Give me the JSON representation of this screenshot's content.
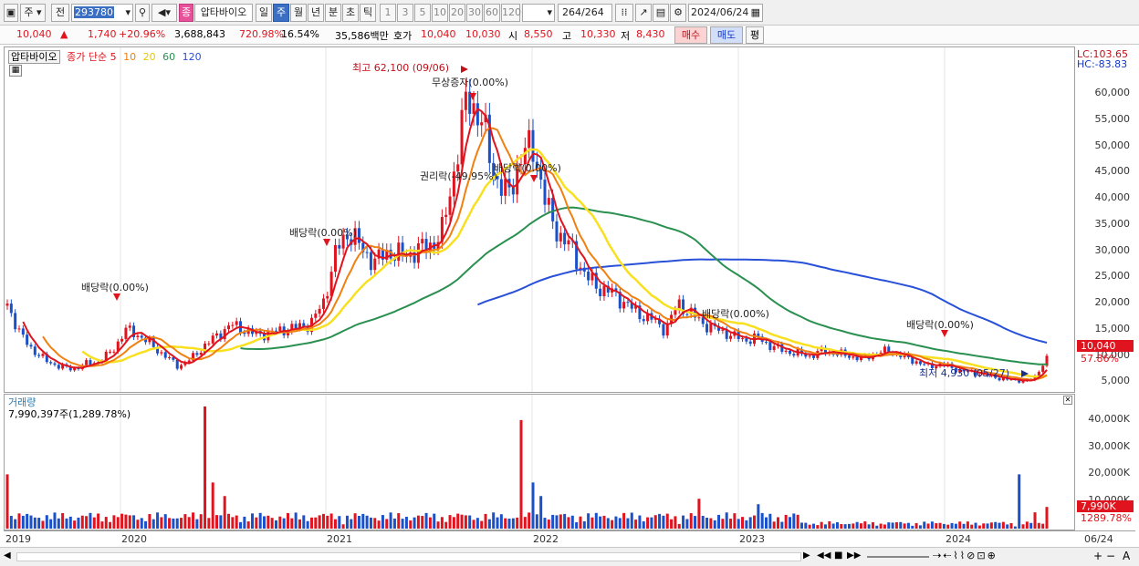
{
  "toolbar": {
    "period_type": "주",
    "prev": "전",
    "code": "293780",
    "name": "압타바이오",
    "intervals": [
      "일",
      "주",
      "월",
      "년",
      "분",
      "초",
      "틱"
    ],
    "selected_interval": "주",
    "minutes": [
      "1",
      "3",
      "5",
      "10",
      "20",
      "30",
      "60",
      "120"
    ],
    "count": "264",
    "count_total": "/264",
    "date": "2024/06/24",
    "pink_label": "종"
  },
  "quote": {
    "price": "10,040",
    "arrow": "▲",
    "change": "1,740",
    "change_pct": "+20.96%",
    "volume": "3,688,843",
    "vol_ratio": "720.98%",
    "turnover": "16.54%",
    "amount": "35,586백만",
    "hoga_label": "호가",
    "ask": "10,040",
    "bid": "10,030",
    "open_label": "시",
    "open": "8,550",
    "high_label": "고",
    "high": "10,330",
    "low_label": "저",
    "low": "8,430",
    "buy": "매수",
    "sell": "매도",
    "eval": "평"
  },
  "price_panel": {
    "stock_label": "압타바이오",
    "ma_title": "종가 단순 5",
    "ma_periods": [
      "10",
      "20",
      "60",
      "120"
    ],
    "ma_colors": {
      "5": "#e0141e",
      "10": "#f08010",
      "20": "#f8e020",
      "60": "#2a9050",
      "120": "#2850d8"
    },
    "lc": "LC:103.65",
    "hc": "HC:-83.83",
    "price_tag": "10,040",
    "pct_tag": "57.86%",
    "annotations": {
      "high": "최고 62,100 (09/06)",
      "bonus": "무상증자(0.00%)",
      "rights": "권리락(-49.95%)",
      "div1": "배당락(0.00%)",
      "div2": "배당락(0.00%)",
      "div3": "배당락(0.00%)",
      "div4": "배당락(0.00%)",
      "div5": "배당락(0.00%)",
      "low": "최저 4,930 (05/27)"
    }
  },
  "vol_panel": {
    "title": "거래량",
    "value": "7,990,397주(1,289.78%)",
    "tag": "7,990K",
    "pct_tag": "1289.78%"
  },
  "chart_data": [
    {
      "type": "candlestick",
      "title": "압타바이오",
      "y_ticks": [
        "5,000",
        "10,000",
        "15,000",
        "20,000",
        "25,000",
        "30,000",
        "35,000",
        "40,000",
        "45,000",
        "50,000",
        "55,000",
        "60,000"
      ],
      "ylim": [
        3500,
        64000
      ],
      "x_ticks": [
        "2019",
        "2020",
        "2021",
        "2022",
        "2023",
        "2024",
        "06/24"
      ],
      "series": [
        {
          "name": "5",
          "closes": [
            20000,
            14000,
            11000,
            9000,
            8000,
            7500,
            8500,
            9000,
            11000,
            15000,
            14000,
            12000,
            10000,
            8000,
            9500,
            12000,
            14000,
            16000,
            15000,
            14000,
            14500,
            15000,
            15500,
            16000,
            20000,
            30000,
            34000,
            30000,
            28000,
            30000,
            29000,
            30000,
            31000,
            33000,
            46000,
            60000,
            55000,
            45000,
            40000,
            48000,
            50000,
            38000,
            33000,
            30000,
            25000,
            23000,
            22000,
            20000,
            18000,
            17000,
            15000,
            20000,
            18000,
            16000,
            15000,
            14000,
            13000,
            13500,
            12000,
            11000,
            10500,
            10000,
            11000,
            10500,
            10000,
            9500,
            10500,
            11000,
            10000,
            9000,
            8000,
            8500,
            7500,
            7000,
            6500,
            6000,
            5500,
            5200,
            5500,
            10040
          ]
        }
      ]
    },
    {
      "type": "bar",
      "title": "거래량",
      "y_ticks": [
        "10,000K",
        "20,000K",
        "30,000K",
        "40,000K"
      ],
      "ylim": [
        0,
        47000
      ],
      "note": "volume in thousands of shares"
    }
  ]
}
